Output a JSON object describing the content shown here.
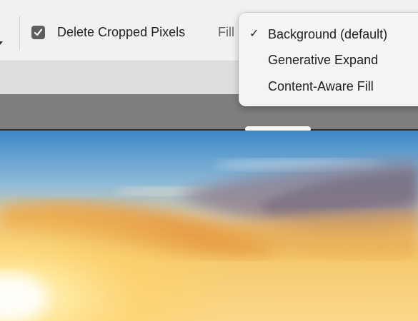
{
  "options_bar": {
    "delete_cropped": {
      "label": "Delete Cropped Pixels",
      "checked": true
    },
    "fill_label": "Fill"
  },
  "fill_dropdown": {
    "items": [
      {
        "label": "Background (default)",
        "selected": true
      },
      {
        "label": "Generative Expand",
        "selected": false
      },
      {
        "label": "Content-Aware Fill",
        "selected": false
      }
    ]
  },
  "colors": {
    "sky_top": "#3a86c4",
    "sky_mid": "#8cb9d9",
    "sun_glow": "#ffd35a",
    "cloud_orange": "#f1a53c"
  }
}
